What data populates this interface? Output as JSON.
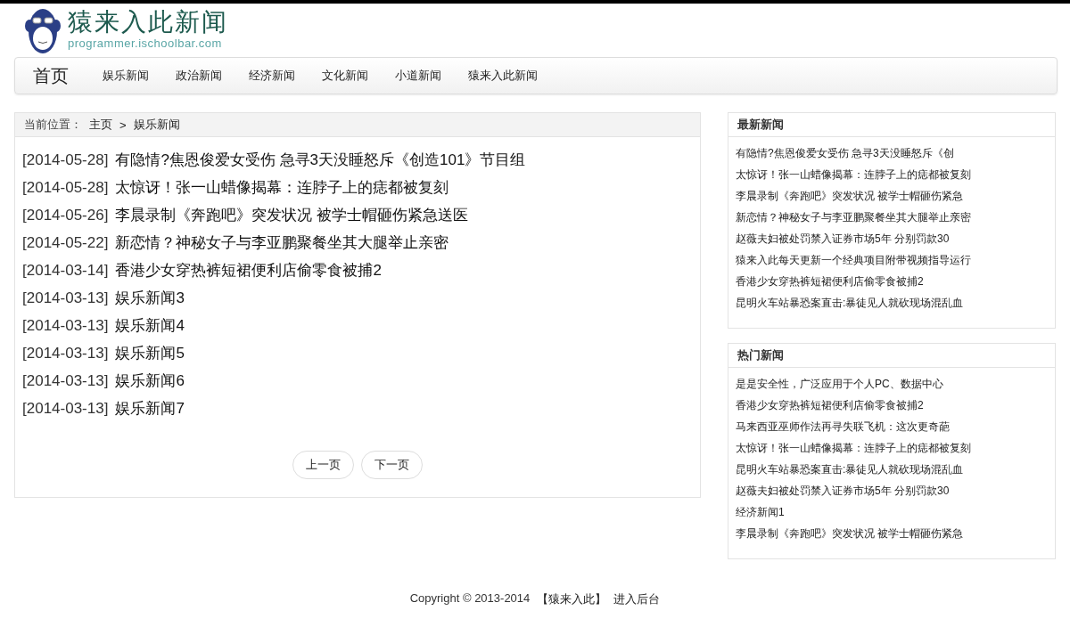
{
  "header": {
    "logo_title": "猿来入此新闻",
    "logo_subtitle": "programmer.ischoolbar.com"
  },
  "nav": {
    "home": "首页",
    "items": [
      {
        "label": "娱乐新闻"
      },
      {
        "label": "政治新闻"
      },
      {
        "label": "经济新闻"
      },
      {
        "label": "文化新闻"
      },
      {
        "label": "小道新闻"
      },
      {
        "label": "猿来入此新闻"
      }
    ]
  },
  "breadcrumb": {
    "label": "当前位置：",
    "home": "主页",
    "separator": ">",
    "current": "娱乐新闻"
  },
  "articles": [
    {
      "date": "[2014-05-28]",
      "title": "有隐情?焦恩俊爱女受伤 急寻3天没睡怒斥《创造101》节目组"
    },
    {
      "date": "[2014-05-28]",
      "title": "太惊讶！张一山蜡像揭幕：连脖子上的痣都被复刻"
    },
    {
      "date": "[2014-05-26]",
      "title": "李晨录制《奔跑吧》突发状况 被学士帽砸伤紧急送医"
    },
    {
      "date": "[2014-05-22]",
      "title": "新恋情？神秘女子与李亚鹏聚餐坐其大腿举止亲密"
    },
    {
      "date": "[2014-03-14]",
      "title": "香港少女穿热裤短裙便利店偷零食被捕2"
    },
    {
      "date": "[2014-03-13]",
      "title": "娱乐新闻3"
    },
    {
      "date": "[2014-03-13]",
      "title": "娱乐新闻4"
    },
    {
      "date": "[2014-03-13]",
      "title": "娱乐新闻5"
    },
    {
      "date": "[2014-03-13]",
      "title": "娱乐新闻6"
    },
    {
      "date": "[2014-03-13]",
      "title": "娱乐新闻7"
    }
  ],
  "pager": {
    "prev": "上一页",
    "next": "下一页"
  },
  "sidebar": [
    {
      "title": "最新新闻",
      "items": [
        "有隐情?焦恩俊爱女受伤 急寻3天没睡怒斥《创",
        "太惊讶！张一山蜡像揭幕：连脖子上的痣都被复刻",
        "李晨录制《奔跑吧》突发状况 被学士帽砸伤紧急",
        "新恋情？神秘女子与李亚鹏聚餐坐其大腿举止亲密",
        "赵薇夫妇被处罚禁入证券市场5年 分别罚款30",
        "猿来入此每天更新一个经典项目附带视频指导运行",
        "香港少女穿热裤短裙便利店偷零食被捕2",
        "昆明火车站暴恐案直击:暴徒见人就砍现场混乱血"
      ]
    },
    {
      "title": "热门新闻",
      "items": [
        "是是安全性，广泛应用于个人PC、数据中心",
        "香港少女穿热裤短裙便利店偷零食被捕2",
        "马来西亚巫师作法再寻失联飞机：这次更奇葩",
        "太惊讶！张一山蜡像揭幕：连脖子上的痣都被复刻",
        "昆明火车站暴恐案直击:暴徒见人就砍现场混乱血",
        "赵薇夫妇被处罚禁入证券市场5年 分别罚款30",
        "经济新闻1",
        "李晨录制《奔跑吧》突发状况 被学士帽砸伤紧急"
      ]
    }
  ],
  "footer": {
    "copyright": "Copyright © 2013-2014",
    "site_link": "【猿来入此】",
    "admin_link": "进入后台"
  }
}
